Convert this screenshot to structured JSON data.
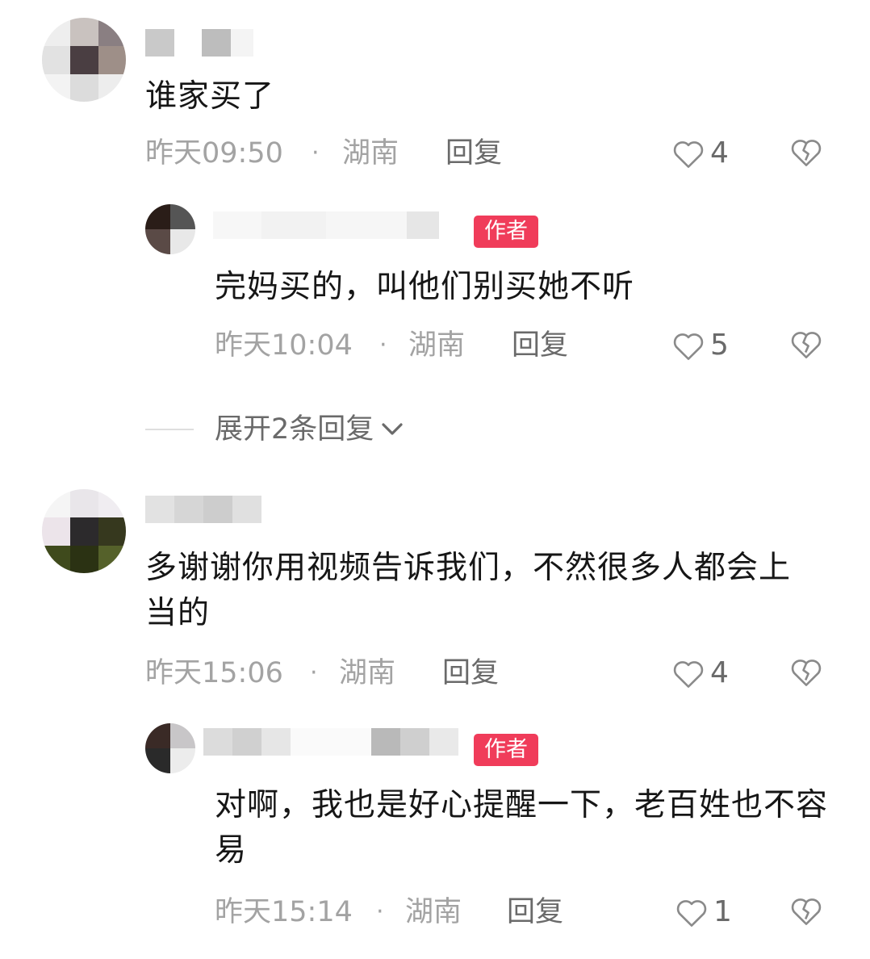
{
  "comments": [
    {
      "text": "谁家买了",
      "time": "昨天09:50",
      "location": "湖南",
      "reply_label": "回复",
      "likes": "4",
      "reply": {
        "badge": "作者",
        "text": "完妈买的，叫他们别买她不听",
        "time": "昨天10:04",
        "location": "湖南",
        "reply_label": "回复",
        "likes": "5"
      },
      "expand_label": "展开2条回复"
    },
    {
      "text": "多谢谢你用视频告诉我们，不然很多人都会上当的",
      "time": "昨天15:06",
      "location": "湖南",
      "reply_label": "回复",
      "likes": "4",
      "reply": {
        "badge": "作者",
        "text": "对啊，我也是好心提醒一下，老百姓也不容易",
        "time": "昨天15:14",
        "location": "湖南",
        "reply_label": "回复",
        "likes": "1"
      }
    }
  ],
  "separator": "·",
  "icons": {
    "like": "heart-outline-icon",
    "dislike": "broken-heart-icon",
    "expand": "chevron-down-icon"
  },
  "colors": {
    "badge": "#f03c5a",
    "meta": "#a3a3a3",
    "action": "#6a6a6a"
  }
}
